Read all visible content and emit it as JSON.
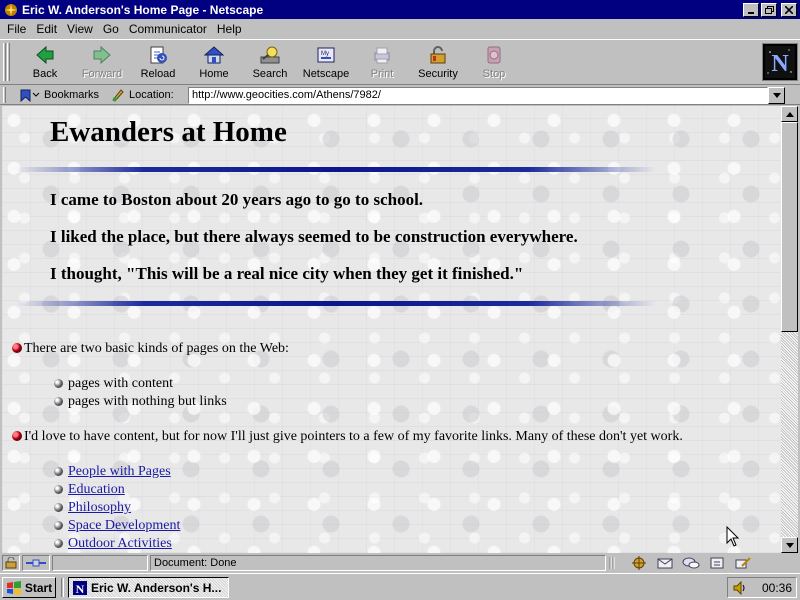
{
  "window": {
    "title": "Eric W. Anderson's Home Page - Netscape",
    "minimize_label": "_",
    "maximize_label": "▫",
    "close_label": "✕"
  },
  "menubar": {
    "items": [
      "File",
      "Edit",
      "View",
      "Go",
      "Communicator",
      "Help"
    ]
  },
  "toolbar": {
    "buttons": [
      {
        "label": "Back",
        "icon": "back-arrow-icon",
        "enabled": true
      },
      {
        "label": "Forward",
        "icon": "forward-arrow-icon",
        "enabled": false
      },
      {
        "label": "Reload",
        "icon": "reload-icon",
        "enabled": true
      },
      {
        "label": "Home",
        "icon": "home-icon",
        "enabled": true
      },
      {
        "label": "Search",
        "icon": "search-icon",
        "enabled": true
      },
      {
        "label": "Netscape",
        "icon": "netscape-icon",
        "enabled": true
      },
      {
        "label": "Print",
        "icon": "print-icon",
        "enabled": false
      },
      {
        "label": "Security",
        "icon": "security-lock-icon",
        "enabled": true
      },
      {
        "label": "Stop",
        "icon": "stop-icon",
        "enabled": false
      }
    ],
    "logo_letter": "N"
  },
  "locationbar": {
    "bookmarks_label": "Bookmarks",
    "location_label": "Location:",
    "url": "http://www.geocities.com/Athens/7982/"
  },
  "page": {
    "heading": "Ewanders at Home",
    "intro_lines": [
      "I came to Boston about 20 years ago to go to school.",
      "I liked the place, but there always seemed to be construction everywhere.",
      "I thought, \"This will be a real nice city when they get it finished.\""
    ],
    "section1": {
      "text": "There are two basic kinds of pages on the Web:",
      "items": [
        "pages with content",
        "pages with nothing but links"
      ]
    },
    "section2": {
      "text": "I'd love to have content, but for now I'll just give pointers to a few of my favorite links. Many of these don't yet work.",
      "links": [
        "People with Pages",
        "Education",
        "Philosophy",
        "Space Development",
        "Outdoor Activities"
      ]
    }
  },
  "statusbar": {
    "message": "Document: Done"
  },
  "taskbar": {
    "start_label": "Start",
    "task_label": "Eric W. Anderson's H...",
    "clock": "00:36"
  },
  "colors": {
    "titlebar": "#000080",
    "chrome": "#c0c0c0",
    "link": "#1a1aa6",
    "rule": "#0b168a"
  }
}
